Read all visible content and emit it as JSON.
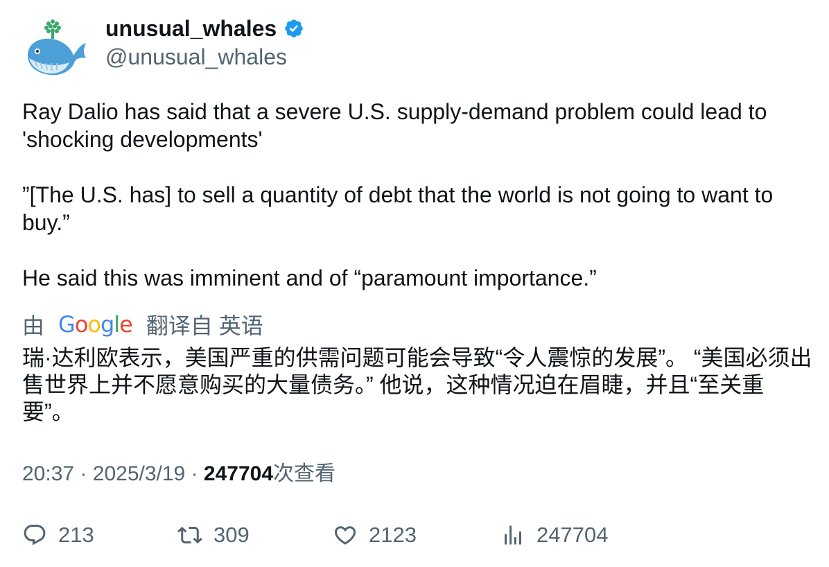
{
  "author": {
    "display_name": "unusual_whales",
    "handle": "@unusual_whales",
    "verified": true,
    "avatar_icon": "whale-avatar-icon"
  },
  "tweet": {
    "paragraph1": "Ray Dalio has said that a severe U.S. supply-demand problem could lead to 'shocking developments'",
    "paragraph2": "”[The U.S. has] to sell a quantity of debt that the world is not going to want to buy.”",
    "paragraph3": "He said this was imminent and of “paramount importance.”"
  },
  "translation": {
    "prefix": "由",
    "provider": "Google",
    "suffix": "翻译自 英语",
    "text": "瑞·达利欧表示，美国严重的供需问题可能会导致“令人震惊的发展”。 “美国必须出售世界上并不愿意购买的大量债务。” 他说，这种情况迫在眉睫，并且“至关重要”。"
  },
  "meta": {
    "time": "20:37",
    "separator": "·",
    "date": "2025/3/19",
    "views": "247704",
    "views_label": "次查看"
  },
  "actions": {
    "replies": "213",
    "retweets": "309",
    "likes": "2123",
    "views": "247704"
  },
  "colors": {
    "text": "#0f1419",
    "secondary": "#536471",
    "verified": "#1d9bf0"
  }
}
